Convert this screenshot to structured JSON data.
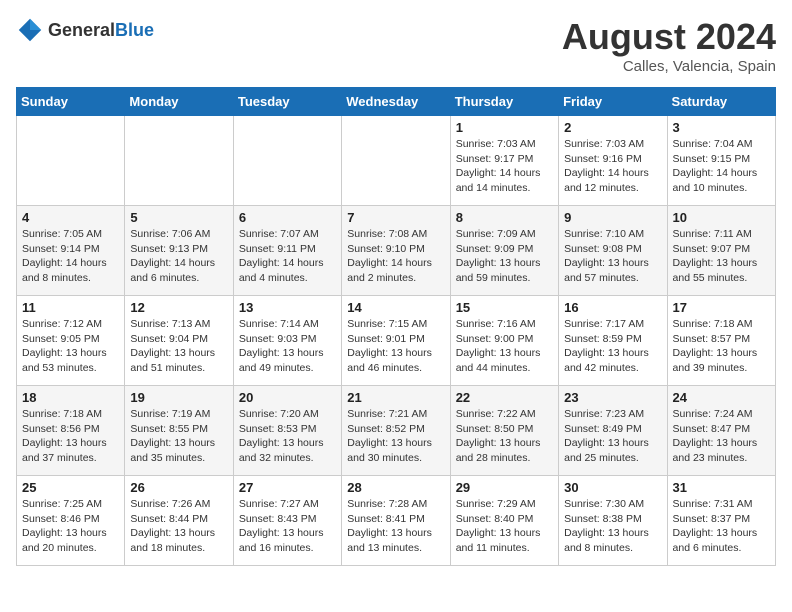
{
  "header": {
    "logo_general": "General",
    "logo_blue": "Blue",
    "month_year": "August 2024",
    "location": "Calles, Valencia, Spain"
  },
  "weekdays": [
    "Sunday",
    "Monday",
    "Tuesday",
    "Wednesday",
    "Thursday",
    "Friday",
    "Saturday"
  ],
  "weeks": [
    [
      {
        "day": "",
        "info": ""
      },
      {
        "day": "",
        "info": ""
      },
      {
        "day": "",
        "info": ""
      },
      {
        "day": "",
        "info": ""
      },
      {
        "day": "1",
        "info": "Sunrise: 7:03 AM\nSunset: 9:17 PM\nDaylight: 14 hours\nand 14 minutes."
      },
      {
        "day": "2",
        "info": "Sunrise: 7:03 AM\nSunset: 9:16 PM\nDaylight: 14 hours\nand 12 minutes."
      },
      {
        "day": "3",
        "info": "Sunrise: 7:04 AM\nSunset: 9:15 PM\nDaylight: 14 hours\nand 10 minutes."
      }
    ],
    [
      {
        "day": "4",
        "info": "Sunrise: 7:05 AM\nSunset: 9:14 PM\nDaylight: 14 hours\nand 8 minutes."
      },
      {
        "day": "5",
        "info": "Sunrise: 7:06 AM\nSunset: 9:13 PM\nDaylight: 14 hours\nand 6 minutes."
      },
      {
        "day": "6",
        "info": "Sunrise: 7:07 AM\nSunset: 9:11 PM\nDaylight: 14 hours\nand 4 minutes."
      },
      {
        "day": "7",
        "info": "Sunrise: 7:08 AM\nSunset: 9:10 PM\nDaylight: 14 hours\nand 2 minutes."
      },
      {
        "day": "8",
        "info": "Sunrise: 7:09 AM\nSunset: 9:09 PM\nDaylight: 13 hours\nand 59 minutes."
      },
      {
        "day": "9",
        "info": "Sunrise: 7:10 AM\nSunset: 9:08 PM\nDaylight: 13 hours\nand 57 minutes."
      },
      {
        "day": "10",
        "info": "Sunrise: 7:11 AM\nSunset: 9:07 PM\nDaylight: 13 hours\nand 55 minutes."
      }
    ],
    [
      {
        "day": "11",
        "info": "Sunrise: 7:12 AM\nSunset: 9:05 PM\nDaylight: 13 hours\nand 53 minutes."
      },
      {
        "day": "12",
        "info": "Sunrise: 7:13 AM\nSunset: 9:04 PM\nDaylight: 13 hours\nand 51 minutes."
      },
      {
        "day": "13",
        "info": "Sunrise: 7:14 AM\nSunset: 9:03 PM\nDaylight: 13 hours\nand 49 minutes."
      },
      {
        "day": "14",
        "info": "Sunrise: 7:15 AM\nSunset: 9:01 PM\nDaylight: 13 hours\nand 46 minutes."
      },
      {
        "day": "15",
        "info": "Sunrise: 7:16 AM\nSunset: 9:00 PM\nDaylight: 13 hours\nand 44 minutes."
      },
      {
        "day": "16",
        "info": "Sunrise: 7:17 AM\nSunset: 8:59 PM\nDaylight: 13 hours\nand 42 minutes."
      },
      {
        "day": "17",
        "info": "Sunrise: 7:18 AM\nSunset: 8:57 PM\nDaylight: 13 hours\nand 39 minutes."
      }
    ],
    [
      {
        "day": "18",
        "info": "Sunrise: 7:18 AM\nSunset: 8:56 PM\nDaylight: 13 hours\nand 37 minutes."
      },
      {
        "day": "19",
        "info": "Sunrise: 7:19 AM\nSunset: 8:55 PM\nDaylight: 13 hours\nand 35 minutes."
      },
      {
        "day": "20",
        "info": "Sunrise: 7:20 AM\nSunset: 8:53 PM\nDaylight: 13 hours\nand 32 minutes."
      },
      {
        "day": "21",
        "info": "Sunrise: 7:21 AM\nSunset: 8:52 PM\nDaylight: 13 hours\nand 30 minutes."
      },
      {
        "day": "22",
        "info": "Sunrise: 7:22 AM\nSunset: 8:50 PM\nDaylight: 13 hours\nand 28 minutes."
      },
      {
        "day": "23",
        "info": "Sunrise: 7:23 AM\nSunset: 8:49 PM\nDaylight: 13 hours\nand 25 minutes."
      },
      {
        "day": "24",
        "info": "Sunrise: 7:24 AM\nSunset: 8:47 PM\nDaylight: 13 hours\nand 23 minutes."
      }
    ],
    [
      {
        "day": "25",
        "info": "Sunrise: 7:25 AM\nSunset: 8:46 PM\nDaylight: 13 hours\nand 20 minutes."
      },
      {
        "day": "26",
        "info": "Sunrise: 7:26 AM\nSunset: 8:44 PM\nDaylight: 13 hours\nand 18 minutes."
      },
      {
        "day": "27",
        "info": "Sunrise: 7:27 AM\nSunset: 8:43 PM\nDaylight: 13 hours\nand 16 minutes."
      },
      {
        "day": "28",
        "info": "Sunrise: 7:28 AM\nSunset: 8:41 PM\nDaylight: 13 hours\nand 13 minutes."
      },
      {
        "day": "29",
        "info": "Sunrise: 7:29 AM\nSunset: 8:40 PM\nDaylight: 13 hours\nand 11 minutes."
      },
      {
        "day": "30",
        "info": "Sunrise: 7:30 AM\nSunset: 8:38 PM\nDaylight: 13 hours\nand 8 minutes."
      },
      {
        "day": "31",
        "info": "Sunrise: 7:31 AM\nSunset: 8:37 PM\nDaylight: 13 hours\nand 6 minutes."
      }
    ]
  ]
}
